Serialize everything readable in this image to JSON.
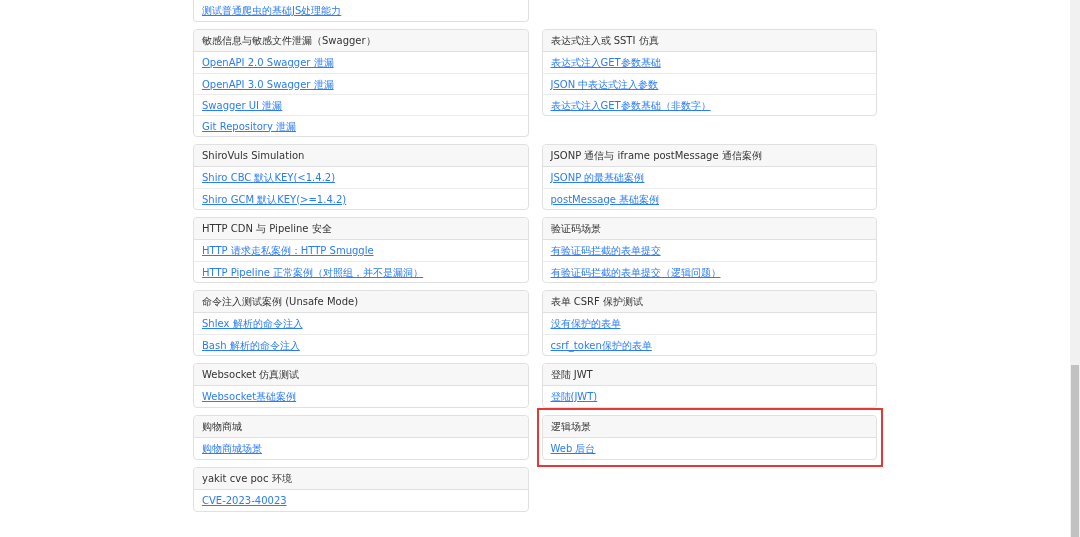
{
  "rows": [
    {
      "left": {
        "links": [
          "测试普通爬虫的基础JS处理能力"
        ]
      },
      "right": null
    },
    {
      "left": {
        "title": "敏感信息与敏感文件泄漏（Swagger）",
        "links": [
          "OpenAPI 2.0 Swagger 泄漏",
          "OpenAPI 3.0 Swagger 泄漏",
          "Swagger UI 泄漏",
          "Git Repository 泄漏"
        ]
      },
      "right": {
        "title": "表达式注入或 SSTI 仿真",
        "links": [
          "表达式注入GET参数基础",
          "JSON 中表达式注入参数",
          "表达式注入GET参数基础（非数字）"
        ]
      }
    },
    {
      "left": {
        "title": "ShiroVuls Simulation",
        "links": [
          "Shiro CBC 默认KEY(<1.4.2)",
          "Shiro GCM 默认KEY(>=1.4.2)"
        ]
      },
      "right": {
        "title": "JSONP 通信与 iframe postMessage 通信案例",
        "links": [
          "JSONP 的最基础案例",
          "postMessage 基础案例"
        ]
      }
    },
    {
      "left": {
        "title": "HTTP CDN 与 Pipeline 安全",
        "links": [
          "HTTP 请求走私案例：HTTP Smuggle",
          "HTTP Pipeline 正常案例（对照组，并不是漏洞）"
        ]
      },
      "right": {
        "title": "验证码场景",
        "links": [
          "有验证码拦截的表单提交",
          "有验证码拦截的表单提交（逻辑问题）"
        ]
      }
    },
    {
      "left": {
        "title": "命令注入测试案例 (Unsafe Mode)",
        "links": [
          "Shlex 解析的命令注入",
          "Bash 解析的命令注入"
        ]
      },
      "right": {
        "title": "表单 CSRF 保护测试",
        "links": [
          "没有保护的表单",
          "csrf_token保护的表单"
        ]
      }
    },
    {
      "left": {
        "title": "Websocket 仿真测试",
        "links": [
          "Websocket基础案例"
        ]
      },
      "right": {
        "title": "登陆 JWT",
        "links": [
          "登陆(JWT)"
        ]
      }
    },
    {
      "left": {
        "title": "购物商城",
        "links": [
          "购物商城场景"
        ]
      },
      "right": {
        "title": "逻辑场景",
        "links": [
          "Web 后台"
        ],
        "highlighted": true
      }
    },
    {
      "left": {
        "title": "yakit cve poc 环境",
        "links": [
          "CVE-2023-40023"
        ]
      },
      "right": null
    }
  ]
}
